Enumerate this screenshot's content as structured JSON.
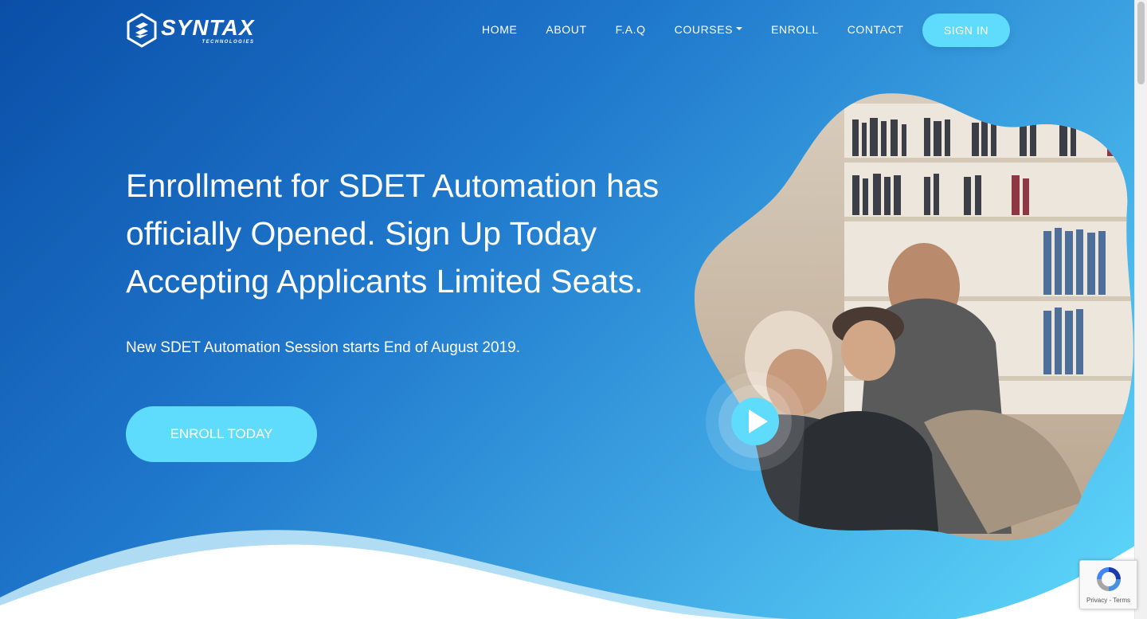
{
  "brand": {
    "name": "SYNTAX",
    "tagline": "TECHNOLOGIES"
  },
  "nav": {
    "items": [
      {
        "label": "HOME"
      },
      {
        "label": "ABOUT"
      },
      {
        "label": "F.A.Q"
      },
      {
        "label": "COURSES",
        "dropdown": true
      },
      {
        "label": "ENROLL"
      },
      {
        "label": "CONTACT"
      }
    ],
    "signin_label": "SIGN IN"
  },
  "hero": {
    "headline": "Enrollment for SDET Automation has officially Opened. Sign Up Today Accepting Applicants Limited Seats.",
    "subheadline": "New SDET Automation Session starts End of August 2019.",
    "cta_label": "ENROLL TODAY"
  },
  "media": {
    "play_icon": "play-icon",
    "image_subject": "photo-people-laughing-library"
  },
  "recaptcha": {
    "privacy": "Privacy",
    "separator": " - ",
    "terms": "Terms"
  },
  "colors": {
    "gradient_start": "#0a4ea8",
    "gradient_end": "#5fd9fb",
    "accent_button": "#5fdcfb",
    "text": "#ffffff"
  }
}
